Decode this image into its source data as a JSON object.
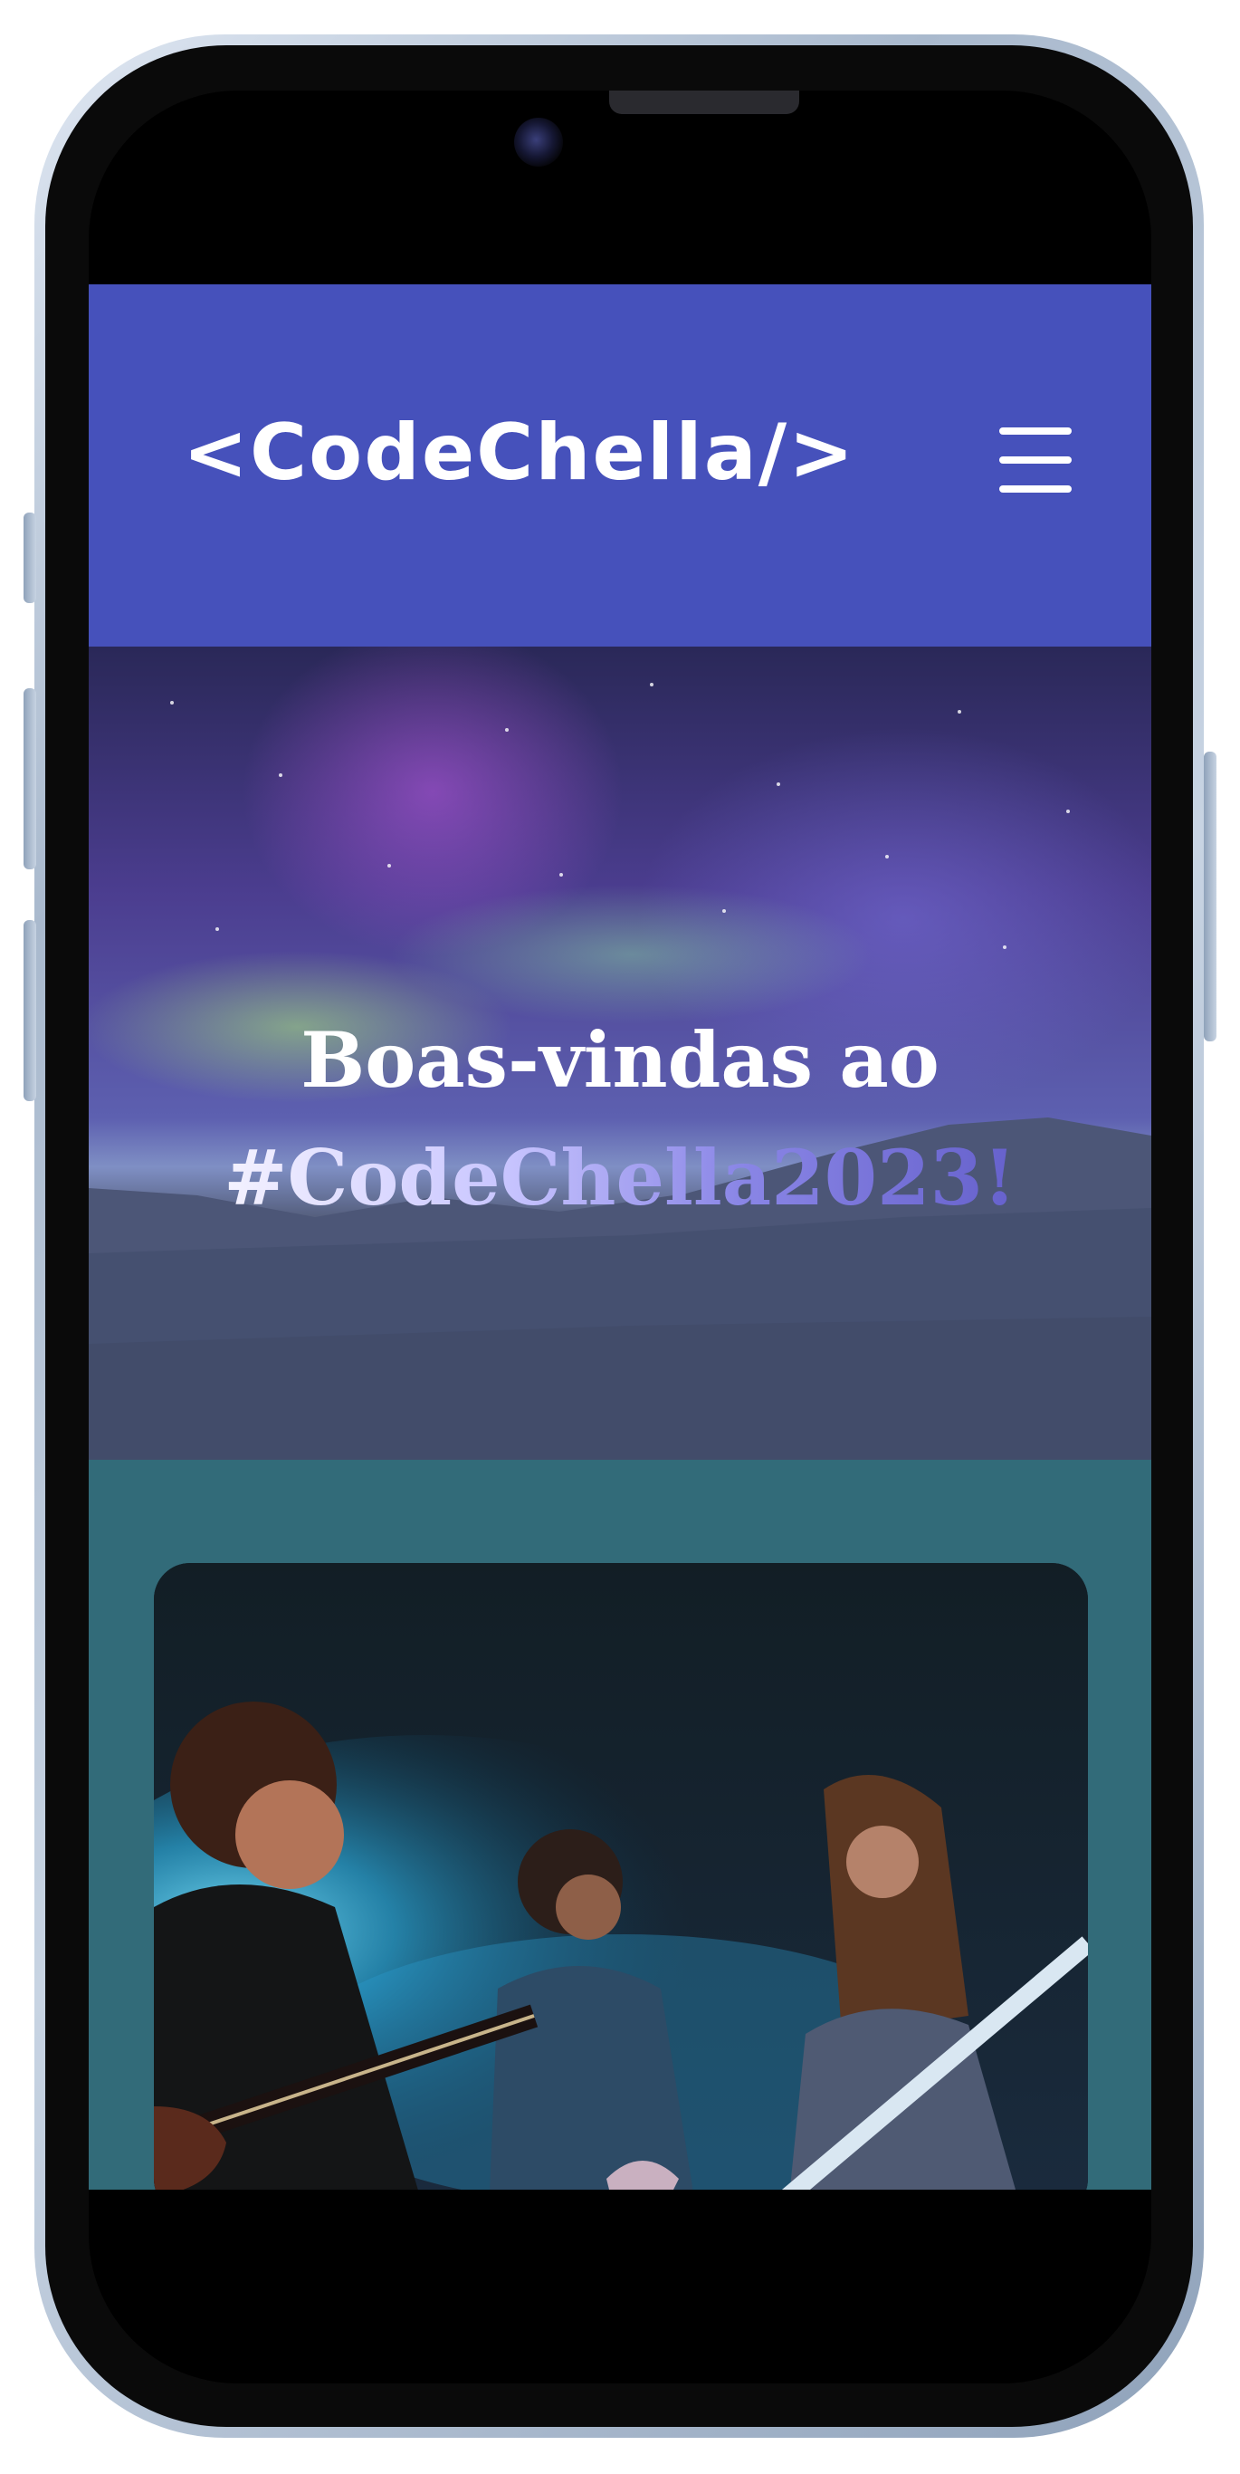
{
  "header": {
    "logo_text": "<CodeChella/>",
    "menu_icon": "hamburger-menu-icon",
    "background_color": "#4651bb"
  },
  "hero": {
    "title_line1": "Boas-vindas ao",
    "title_line2": "#CodeChella2023!"
  },
  "band_image": {
    "description_icon": "band-photo"
  },
  "colors": {
    "page_background": "#326b79",
    "header_background": "#4651bb",
    "gradient_start": "#f4f2ff",
    "gradient_end": "#6661cc"
  }
}
